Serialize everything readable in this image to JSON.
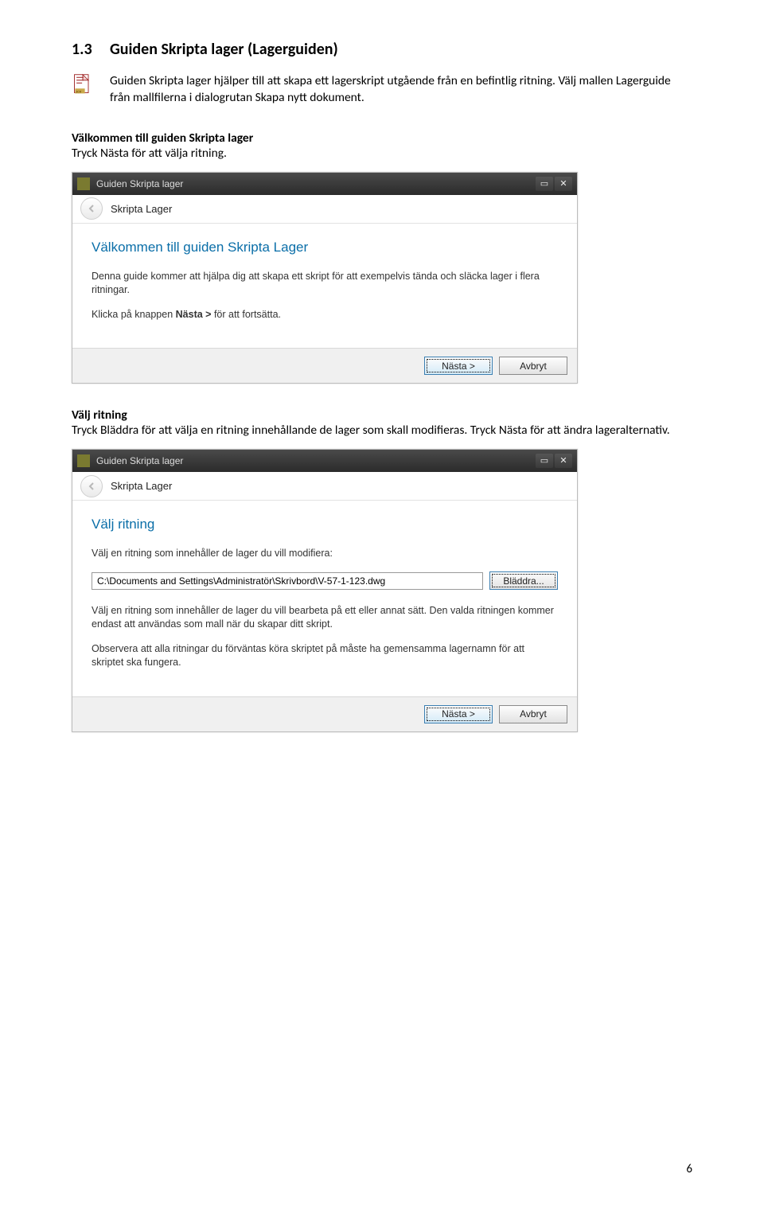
{
  "section": {
    "number": "1.3",
    "title": "Guiden Skripta lager (Lagerguiden)"
  },
  "intro": "Guiden Skripta lager hjälper till att skapa ett lagerskript utgående från en befintlig ritning. Välj mallen Lagerguide från mallfilerna i dialogrutan Skapa nytt dokument.",
  "block1": {
    "heading": "Välkommen till guiden Skripta lager",
    "text": "Tryck Nästa för att välja ritning."
  },
  "block2": {
    "heading": "Välj ritning",
    "text": "Tryck Bläddra för att välja en ritning innehållande de lager som skall modifieras. Tryck Nästa för att ändra lageralternativ."
  },
  "dialog1": {
    "title": "Guiden Skripta lager",
    "breadcrumb": "Skripta Lager",
    "heading": "Välkommen till guiden Skripta Lager",
    "body1": "Denna guide kommer att hjälpa dig att skapa ett skript för att exempelvis tända och släcka lager i flera ritningar.",
    "body2a": "Klicka på knappen ",
    "body2bold": "Nästa >",
    "body2b": " för att fortsätta.",
    "next": "Nästa >",
    "cancel": "Avbryt"
  },
  "dialog2": {
    "title": "Guiden Skripta lager",
    "breadcrumb": "Skripta Lager",
    "heading": "Välj ritning",
    "label": "Välj en ritning som innehåller de lager du vill modifiera:",
    "path": "C:\\Documents and Settings\\Administratör\\Skrivbord\\V-57-1-123.dwg",
    "browse": "Bläddra...",
    "body1": "Välj en ritning som innehåller de lager du vill bearbeta på ett eller annat sätt. Den valda ritningen kommer endast att användas som mall när du skapar ditt skript.",
    "body2": "Observera att alla ritningar du förväntas köra skriptet på måste ha gemensamma lagernamn för att skriptet ska fungera.",
    "next": "Nästa >",
    "cancel": "Avbryt"
  },
  "page_number": "6"
}
